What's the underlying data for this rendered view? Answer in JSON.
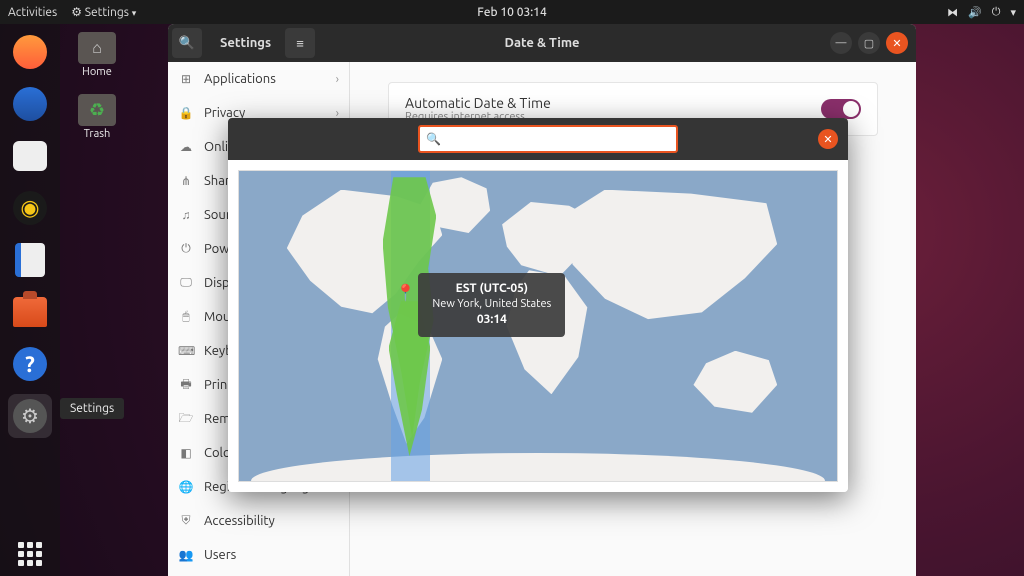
{
  "topbar": {
    "activities": "Activities",
    "settings_menu": "Settings",
    "clock": "Feb 10  03:14"
  },
  "desktop": {
    "home": "Home",
    "trash": "Trash"
  },
  "dock_tooltip": "Settings",
  "settings_window": {
    "app_title": "Settings",
    "page_title": "Date & Time",
    "sidebar": [
      {
        "icon": "⊞",
        "label": "Applications",
        "expandable": true
      },
      {
        "icon": "🔒",
        "label": "Privacy",
        "expandable": true
      },
      {
        "icon": "☁",
        "label": "Online Accounts",
        "expandable": false
      },
      {
        "icon": "⋔",
        "label": "Sharing",
        "expandable": false
      },
      {
        "icon": "♫",
        "label": "Sound",
        "expandable": false
      },
      {
        "icon": "⏻",
        "label": "Power",
        "expandable": false
      },
      {
        "icon": "🖵",
        "label": "Displays",
        "expandable": false
      },
      {
        "icon": "🖱",
        "label": "Mouse & Touchpad",
        "expandable": false
      },
      {
        "icon": "⌨",
        "label": "Keyboard Shortcuts",
        "expandable": false
      },
      {
        "icon": "🖶",
        "label": "Printers",
        "expandable": false
      },
      {
        "icon": "🗁",
        "label": "Removable Media",
        "expandable": false
      },
      {
        "icon": "◧",
        "label": "Color",
        "expandable": false
      },
      {
        "icon": "🌐",
        "label": "Region & Language",
        "expandable": false
      },
      {
        "icon": "⛨",
        "label": "Accessibility",
        "expandable": false
      },
      {
        "icon": "👥",
        "label": "Users",
        "expandable": false
      }
    ],
    "auto_dt": {
      "title": "Automatic Date & Time",
      "sub": "Requires internet access"
    }
  },
  "tz_dialog": {
    "search_placeholder": "",
    "tooltip": {
      "zone": "EST (UTC-05)",
      "loc": "New York, United States",
      "time": "03:14"
    }
  }
}
